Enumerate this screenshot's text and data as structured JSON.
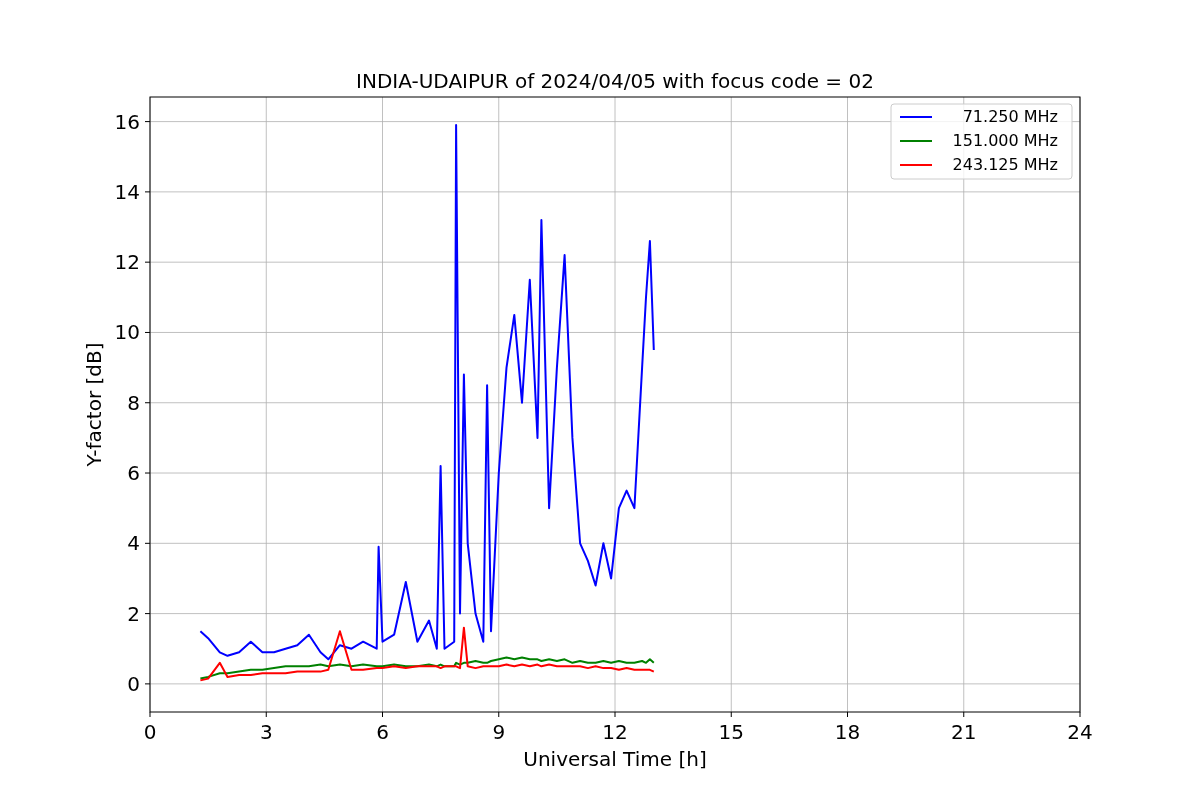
{
  "chart_data": {
    "type": "line",
    "title": "INDIA-UDAIPUR of 2024/04/05 with focus code = 02",
    "xlabel": "Universal Time [h]",
    "ylabel": "Y-factor [dB]",
    "x": [
      1.3,
      1.5,
      1.8,
      2.0,
      2.3,
      2.6,
      2.9,
      3.2,
      3.5,
      3.8,
      4.1,
      4.4,
      4.6,
      4.9,
      5.2,
      5.5,
      5.85,
      5.9,
      6.0,
      6.3,
      6.6,
      6.9,
      7.2,
      7.4,
      7.5,
      7.6,
      7.85,
      7.9,
      8.0,
      8.1,
      8.2,
      8.4,
      8.6,
      8.7,
      8.8,
      9.0,
      9.2,
      9.4,
      9.6,
      9.8,
      10.0,
      10.1,
      10.3,
      10.5,
      10.7,
      10.9,
      11.1,
      11.3,
      11.5,
      11.7,
      11.9,
      12.1,
      12.3,
      12.5,
      12.7,
      12.8,
      12.9,
      13.0
    ],
    "series": [
      {
        "name": "71.250 MHz",
        "color": "#0000ff",
        "values": [
          1.5,
          1.3,
          0.9,
          0.8,
          0.9,
          1.2,
          0.9,
          0.9,
          1.0,
          1.1,
          1.4,
          0.9,
          0.7,
          1.1,
          1.0,
          1.2,
          1.0,
          3.9,
          1.2,
          1.4,
          2.9,
          1.2,
          1.8,
          1.0,
          6.2,
          1.0,
          1.2,
          15.9,
          2.0,
          8.8,
          4.0,
          2.0,
          1.2,
          8.5,
          1.5,
          6.0,
          9.0,
          10.5,
          8.0,
          11.5,
          7.0,
          13.2,
          5.0,
          9.0,
          12.2,
          7.0,
          4.0,
          3.5,
          2.8,
          4.0,
          3.0,
          5.0,
          5.5,
          5.0,
          9.0,
          11.0,
          12.6,
          9.5
        ]
      },
      {
        "name": "151.000 MHz",
        "color": "#008000",
        "values": [
          0.15,
          0.2,
          0.3,
          0.3,
          0.35,
          0.4,
          0.4,
          0.45,
          0.5,
          0.5,
          0.5,
          0.55,
          0.5,
          0.55,
          0.5,
          0.55,
          0.5,
          0.5,
          0.5,
          0.55,
          0.5,
          0.5,
          0.55,
          0.5,
          0.55,
          0.5,
          0.5,
          0.6,
          0.55,
          0.6,
          0.6,
          0.65,
          0.6,
          0.6,
          0.65,
          0.7,
          0.75,
          0.7,
          0.75,
          0.7,
          0.7,
          0.65,
          0.7,
          0.65,
          0.7,
          0.6,
          0.65,
          0.6,
          0.6,
          0.65,
          0.6,
          0.65,
          0.6,
          0.6,
          0.65,
          0.6,
          0.7,
          0.6
        ]
      },
      {
        "name": "243.125 MHz",
        "color": "#ff0000",
        "values": [
          0.1,
          0.15,
          0.6,
          0.2,
          0.25,
          0.25,
          0.3,
          0.3,
          0.3,
          0.35,
          0.35,
          0.35,
          0.4,
          1.5,
          0.4,
          0.4,
          0.45,
          0.45,
          0.45,
          0.5,
          0.45,
          0.5,
          0.5,
          0.5,
          0.45,
          0.5,
          0.5,
          0.5,
          0.45,
          1.6,
          0.5,
          0.45,
          0.5,
          0.5,
          0.5,
          0.5,
          0.55,
          0.5,
          0.55,
          0.5,
          0.55,
          0.5,
          0.55,
          0.5,
          0.5,
          0.5,
          0.5,
          0.45,
          0.5,
          0.45,
          0.45,
          0.4,
          0.45,
          0.4,
          0.4,
          0.4,
          0.4,
          0.35
        ]
      }
    ],
    "grid": true,
    "legend": true,
    "xlim": [
      0,
      24
    ],
    "ylim": [
      -0.8,
      16.7
    ],
    "xticks": [
      0,
      3,
      6,
      9,
      12,
      15,
      18,
      21,
      24
    ],
    "yticks": [
      0,
      2,
      4,
      6,
      8,
      10,
      12,
      14,
      16
    ]
  }
}
